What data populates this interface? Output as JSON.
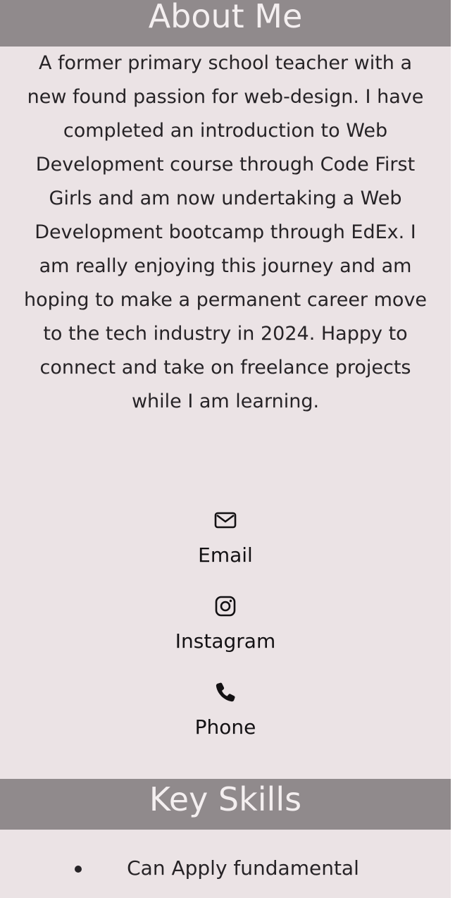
{
  "about": {
    "heading": "About Me",
    "bio": "A former primary school teacher with a new found passion for web-design. I have completed an introduction to Web Development course through Code First Girls and am now undertaking a Web Development bootcamp through EdEx. I am really enjoying this journey and am hoping to make a permanent career move to the tech industry in 2024. Happy to connect and take on freelance projects while I am learning."
  },
  "contacts": [
    {
      "label": "Email",
      "icon": "envelope-icon"
    },
    {
      "label": "Instagram",
      "icon": "instagram-icon"
    },
    {
      "label": "Phone",
      "icon": "phone-icon"
    }
  ],
  "skills": {
    "heading": "Key Skills",
    "items": [
      "Can Apply fundamental"
    ]
  },
  "colors": {
    "header_bg": "#908a8c",
    "page_bg": "#ebe3e5",
    "header_text": "#f4eff0",
    "body_text": "#262326"
  }
}
